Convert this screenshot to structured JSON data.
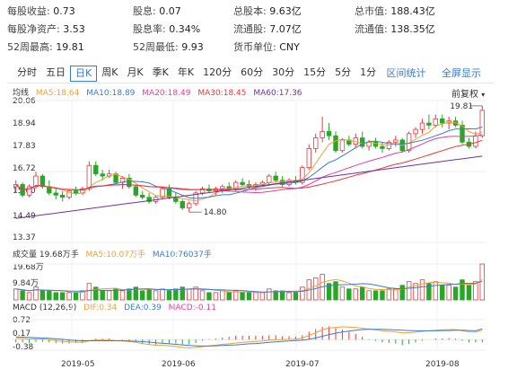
{
  "stats": [
    {
      "label": "每股收益:",
      "value": "0.73"
    },
    {
      "label": "股息:",
      "value": "0.07"
    },
    {
      "label": "总股本:",
      "value": "9.63亿"
    },
    {
      "label": "总市值:",
      "value": "188.43亿"
    },
    {
      "label": "每股净资产:",
      "value": "3.53"
    },
    {
      "label": "股息率:",
      "value": "0.34%"
    },
    {
      "label": "流通股:",
      "value": "7.07亿"
    },
    {
      "label": "流通值:",
      "value": "138.35亿"
    },
    {
      "label": "52周最高:",
      "value": "19.81"
    },
    {
      "label": "52周最低:",
      "value": "9.93"
    },
    {
      "label": "货币单位:",
      "value": "CNY"
    }
  ],
  "tabs": [
    "分时",
    "五日",
    "日K",
    "周K",
    "月K",
    "季K",
    "年K",
    "120分",
    "60分",
    "30分",
    "15分",
    "5分",
    "1分"
  ],
  "active_tab": "日K",
  "right_links": {
    "interval": "区间统计",
    "fullscreen": "全屏显示"
  },
  "price_legend": {
    "kline": "均线",
    "ma5": "MA5:18.64",
    "ma10": "MA10:18.89",
    "ma20": "MA20:18.49",
    "ma30": "MA30:18.45",
    "ma60": "MA60:17.36"
  },
  "adjust_label": "前复权",
  "price_axis": [
    "20.06",
    "18.94",
    "17.83",
    "16.72",
    "15.60",
    "14.49",
    "13.37"
  ],
  "annotations": {
    "high": "19.81",
    "low": "14.80"
  },
  "volume_legend": {
    "title": "成交量 19.68万手",
    "ma5": "MA5:10.07万手",
    "ma10": "MA10:76037手"
  },
  "volume_axis": [
    "19.68万",
    "9.84万"
  ],
  "macd_legend": {
    "title": "MACD (12,26,9)",
    "dif": "DIF:0.34",
    "dea": "DEA:0.39",
    "macd": "MACD:-0.11"
  },
  "macd_axis": [
    "0.72",
    "0.17",
    "-0.38"
  ],
  "dates": [
    "2019-05",
    "2019-06",
    "2019-07",
    "2019-08"
  ],
  "colors": {
    "up": "#e8383d",
    "down": "#26a826",
    "ma5": "#f0a030",
    "ma10": "#3a7bd5",
    "ma20": "#e040a0",
    "ma30": "#e8383d",
    "ma60": "#7030a0",
    "accent": "#3a7bd5"
  },
  "chart_data": {
    "type": "candlestick",
    "x_ticks": [
      "2019-05",
      "2019-06",
      "2019-07",
      "2019-08"
    ],
    "ylim": [
      13.37,
      20.06
    ],
    "candles": [
      [
        16.0,
        16.3,
        15.7,
        16.1
      ],
      [
        16.1,
        16.2,
        15.5,
        15.6
      ],
      [
        15.6,
        16.1,
        15.5,
        16.0
      ],
      [
        16.0,
        16.7,
        15.9,
        16.5
      ],
      [
        16.5,
        16.6,
        15.9,
        16.0
      ],
      [
        16.0,
        16.3,
        15.6,
        15.7
      ],
      [
        15.7,
        15.9,
        15.4,
        15.6
      ],
      [
        15.6,
        15.8,
        15.3,
        15.5
      ],
      [
        15.5,
        15.9,
        15.4,
        15.8
      ],
      [
        15.8,
        16.0,
        15.6,
        15.7
      ],
      [
        15.7,
        16.0,
        15.6,
        15.9
      ],
      [
        15.9,
        17.2,
        15.8,
        17.0
      ],
      [
        17.0,
        17.2,
        16.5,
        16.6
      ],
      [
        16.6,
        16.8,
        16.3,
        16.5
      ],
      [
        16.5,
        16.8,
        16.4,
        16.6
      ],
      [
        16.6,
        16.7,
        16.1,
        16.2
      ],
      [
        16.2,
        16.5,
        15.9,
        16.4
      ],
      [
        16.4,
        16.6,
        15.9,
        16.0
      ],
      [
        16.0,
        16.1,
        15.5,
        15.6
      ],
      [
        15.6,
        15.8,
        15.4,
        15.5
      ],
      [
        15.5,
        15.7,
        15.2,
        15.3
      ],
      [
        15.3,
        15.6,
        15.2,
        15.5
      ],
      [
        15.5,
        16.0,
        15.4,
        15.9
      ],
      [
        15.9,
        16.1,
        15.4,
        15.5
      ],
      [
        15.5,
        15.7,
        15.2,
        15.3
      ],
      [
        15.3,
        15.4,
        14.9,
        15.0
      ],
      [
        15.0,
        15.3,
        14.8,
        15.2
      ],
      [
        15.2,
        15.8,
        15.1,
        15.7
      ],
      [
        15.7,
        16.0,
        15.6,
        15.9
      ],
      [
        15.9,
        16.1,
        15.7,
        15.8
      ],
      [
        15.8,
        16.0,
        15.6,
        15.9
      ],
      [
        15.9,
        16.1,
        15.7,
        16.0
      ],
      [
        16.0,
        16.2,
        15.8,
        15.9
      ],
      [
        15.9,
        16.3,
        15.8,
        16.2
      ],
      [
        16.2,
        16.4,
        16.0,
        16.1
      ],
      [
        16.1,
        16.3,
        15.9,
        16.0
      ],
      [
        16.0,
        16.2,
        15.8,
        16.1
      ],
      [
        16.1,
        16.3,
        16.0,
        16.2
      ],
      [
        16.2,
        16.6,
        16.1,
        16.5
      ],
      [
        16.5,
        16.7,
        16.2,
        16.3
      ],
      [
        16.3,
        16.5,
        16.0,
        16.1
      ],
      [
        16.1,
        16.4,
        16.0,
        16.3
      ],
      [
        16.3,
        16.5,
        16.1,
        16.2
      ],
      [
        16.2,
        17.0,
        16.1,
        16.9
      ],
      [
        16.9,
        18.0,
        16.8,
        17.8
      ],
      [
        17.8,
        18.5,
        17.6,
        18.3
      ],
      [
        18.3,
        19.3,
        18.1,
        18.6
      ],
      [
        18.6,
        19.0,
        18.2,
        18.4
      ],
      [
        18.4,
        18.6,
        17.6,
        17.7
      ],
      [
        17.7,
        18.3,
        17.6,
        18.2
      ],
      [
        18.2,
        18.4,
        17.9,
        18.0
      ],
      [
        18.0,
        18.5,
        17.8,
        18.3
      ],
      [
        18.3,
        18.6,
        17.8,
        17.9
      ],
      [
        17.9,
        18.2,
        17.7,
        18.1
      ],
      [
        18.1,
        18.3,
        17.8,
        17.9
      ],
      [
        17.9,
        18.1,
        17.6,
        17.8
      ],
      [
        17.8,
        18.2,
        17.7,
        18.1
      ],
      [
        18.1,
        18.4,
        17.9,
        18.2
      ],
      [
        18.2,
        18.3,
        17.6,
        17.7
      ],
      [
        17.7,
        18.6,
        17.6,
        18.5
      ],
      [
        18.5,
        18.8,
        18.3,
        18.7
      ],
      [
        18.7,
        19.2,
        18.5,
        19.0
      ],
      [
        19.0,
        19.4,
        18.7,
        18.9
      ],
      [
        18.9,
        19.4,
        18.8,
        19.2
      ],
      [
        19.2,
        19.4,
        18.8,
        19.0
      ],
      [
        19.0,
        19.3,
        18.7,
        19.1
      ],
      [
        19.1,
        19.3,
        18.8,
        18.9
      ],
      [
        18.9,
        19.1,
        18.0,
        18.1
      ],
      [
        18.1,
        18.3,
        17.8,
        17.9
      ],
      [
        17.9,
        18.6,
        17.8,
        18.4
      ],
      [
        18.4,
        19.81,
        18.3,
        19.6
      ]
    ],
    "volume_ylim": [
      0,
      19.68
    ],
    "volume": [
      6,
      5,
      4,
      7,
      5,
      5,
      4,
      4,
      4,
      4,
      5,
      9,
      7,
      5,
      5,
      6,
      5,
      6,
      7,
      5,
      6,
      5,
      6,
      5,
      6,
      7,
      6,
      7,
      5,
      4,
      4,
      5,
      4,
      5,
      4,
      4,
      4,
      4,
      6,
      5,
      5,
      4,
      4,
      7,
      11,
      12,
      14,
      9,
      10,
      7,
      6,
      6,
      7,
      5,
      5,
      5,
      6,
      6,
      8,
      10,
      9,
      11,
      9,
      10,
      8,
      8,
      7,
      11,
      8,
      10,
      19.68
    ],
    "macd_ylim": [
      -0.38,
      0.72
    ],
    "dif": [
      0.05,
      0.04,
      0.02,
      0.03,
      0.02,
      0.0,
      -0.03,
      -0.06,
      -0.08,
      -0.09,
      -0.1,
      -0.04,
      -0.02,
      -0.02,
      -0.02,
      -0.04,
      -0.05,
      -0.07,
      -0.1,
      -0.14,
      -0.18,
      -0.2,
      -0.2,
      -0.22,
      -0.24,
      -0.28,
      -0.3,
      -0.28,
      -0.25,
      -0.22,
      -0.2,
      -0.17,
      -0.15,
      -0.12,
      -0.1,
      -0.08,
      -0.07,
      -0.05,
      -0.02,
      0.0,
      0.0,
      0.01,
      0.02,
      0.06,
      0.15,
      0.25,
      0.35,
      0.42,
      0.44,
      0.46,
      0.45,
      0.44,
      0.41,
      0.38,
      0.35,
      0.32,
      0.3,
      0.28,
      0.24,
      0.25,
      0.27,
      0.3,
      0.32,
      0.34,
      0.35,
      0.36,
      0.36,
      0.32,
      0.28,
      0.27,
      0.34
    ],
    "dea": [
      0.1,
      0.09,
      0.08,
      0.07,
      0.06,
      0.05,
      0.03,
      0.01,
      -0.01,
      -0.03,
      -0.04,
      -0.04,
      -0.04,
      -0.04,
      -0.04,
      -0.04,
      -0.04,
      -0.05,
      -0.06,
      -0.07,
      -0.09,
      -0.11,
      -0.13,
      -0.15,
      -0.17,
      -0.19,
      -0.21,
      -0.22,
      -0.23,
      -0.23,
      -0.22,
      -0.21,
      -0.2,
      -0.19,
      -0.17,
      -0.15,
      -0.14,
      -0.12,
      -0.1,
      -0.08,
      -0.06,
      -0.05,
      -0.03,
      -0.02,
      0.01,
      0.06,
      0.12,
      0.18,
      0.23,
      0.28,
      0.31,
      0.34,
      0.36,
      0.37,
      0.37,
      0.37,
      0.36,
      0.35,
      0.34,
      0.33,
      0.32,
      0.32,
      0.32,
      0.32,
      0.33,
      0.33,
      0.34,
      0.34,
      0.33,
      0.32,
      0.39
    ]
  }
}
